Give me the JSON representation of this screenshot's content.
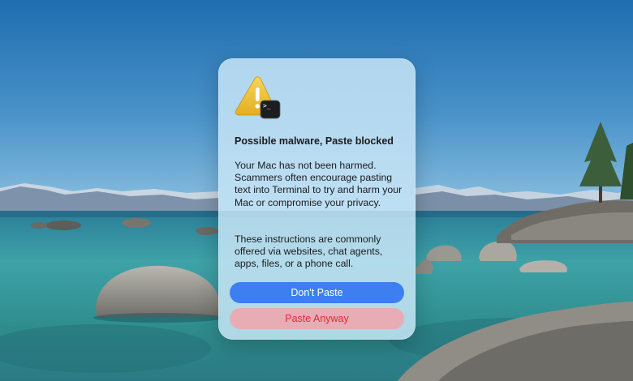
{
  "alert": {
    "title": "Possible malware, Paste blocked",
    "message_1": "Your Mac has not been harmed. Scammers often encourage pasting text into Terminal to try and harm your Mac or compromise your privacy.",
    "message_2": "These instructions are commonly offered via websites, chat agents, apps, files, or a phone call.",
    "icon": "warning-triangle-with-terminal-icon",
    "terminal_prompt": ">_"
  },
  "buttons": {
    "primary_label": "Don't Paste",
    "destructive_label": "Paste Anyway"
  },
  "colors": {
    "primary_button": "#3d7ff0",
    "destructive_text": "#e02b3c",
    "warning_yellow": "#f2c43a"
  },
  "wallpaper": {
    "scene": "lake-with-snowy-mountains"
  }
}
